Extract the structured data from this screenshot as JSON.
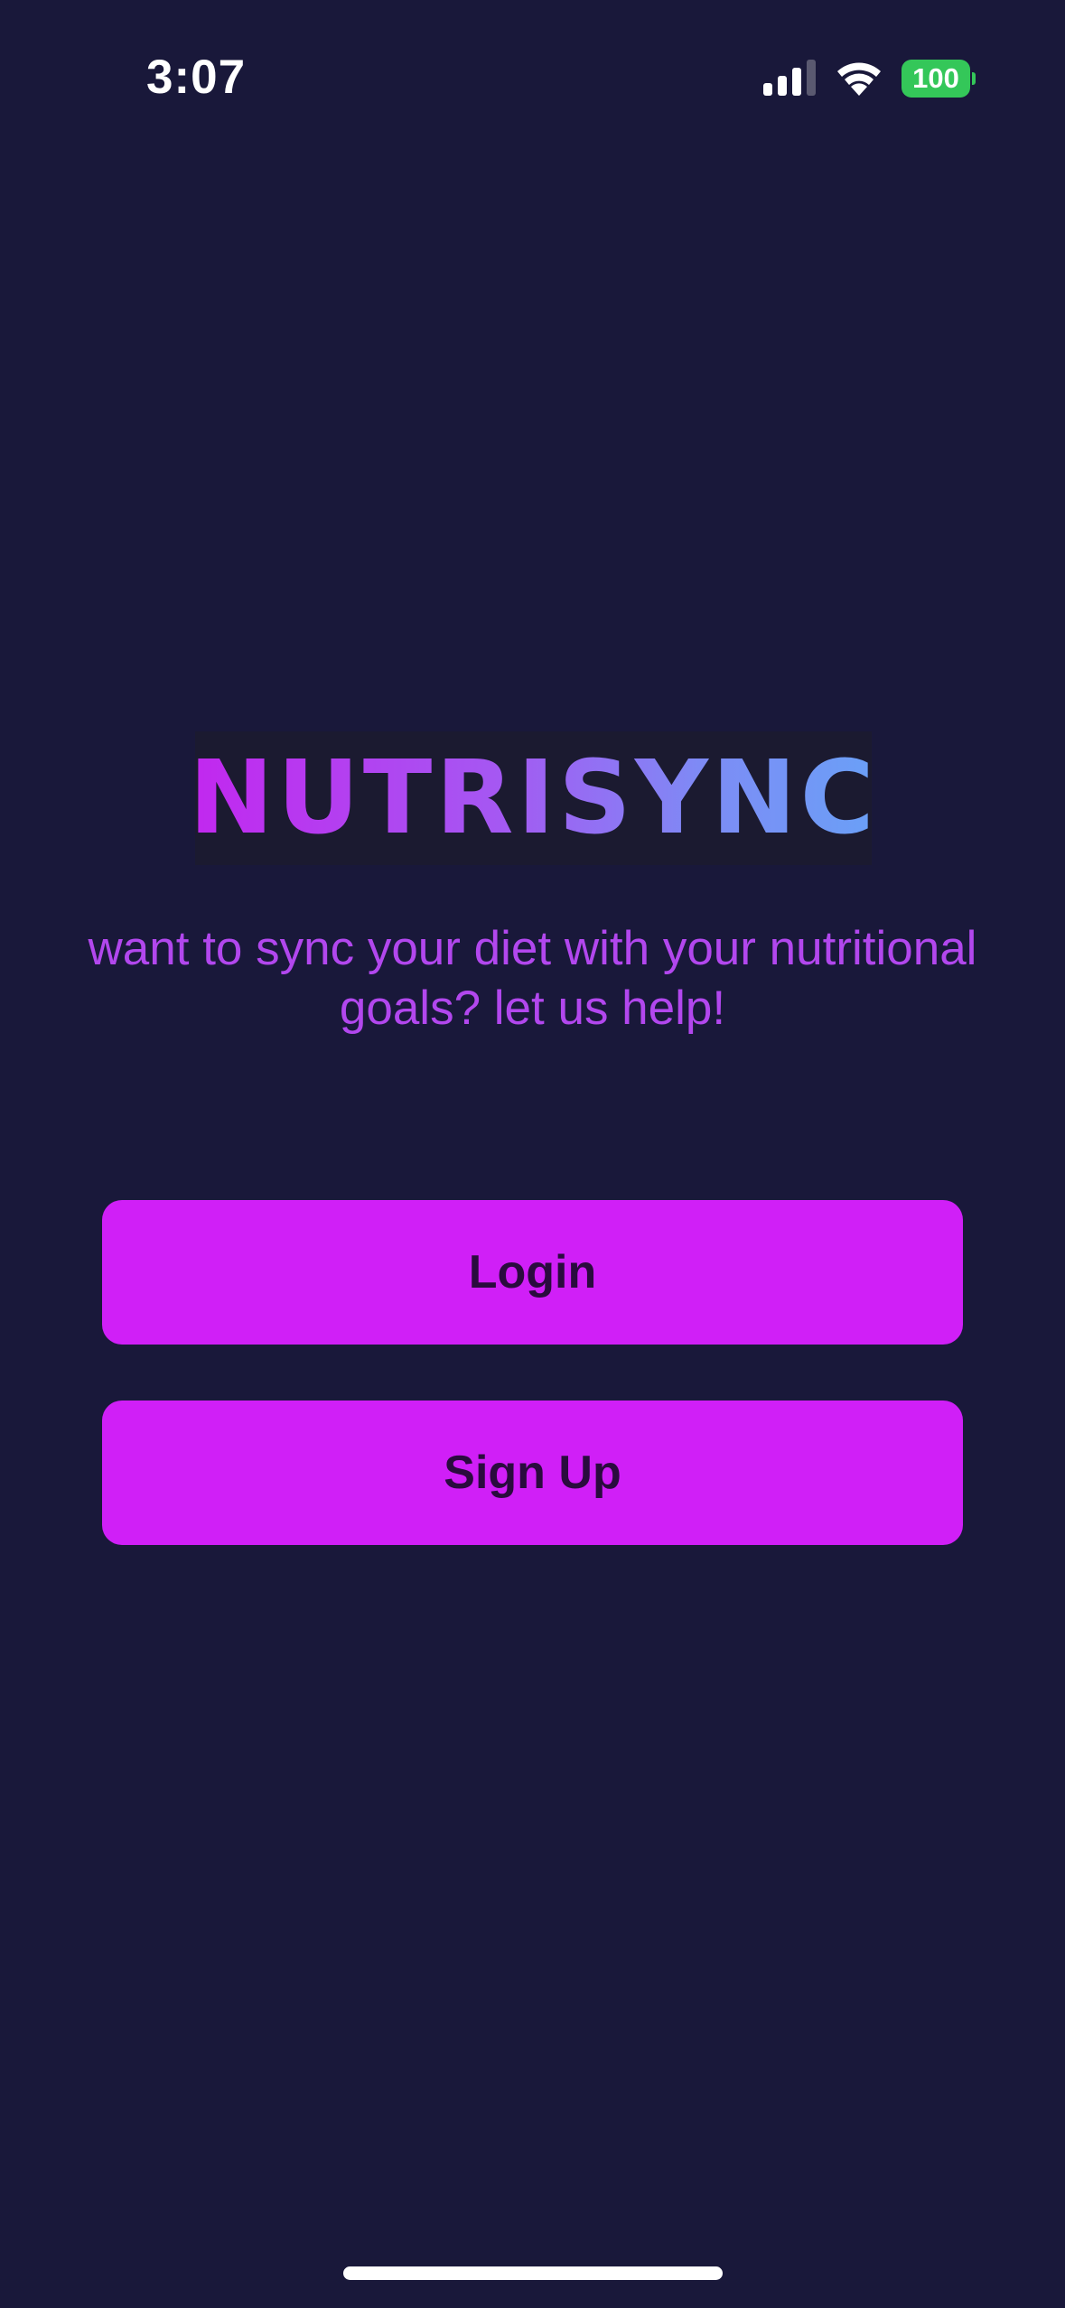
{
  "status_bar": {
    "time": "3:07",
    "battery": "100",
    "signal_icon": "cellular-signal-icon",
    "wifi_icon": "wifi-icon",
    "battery_icon": "battery-icon"
  },
  "app": {
    "logo": "NUTRISYNC",
    "tagline": "want to sync your diet with your nutritional goals? let us help!"
  },
  "actions": {
    "login_label": "Login",
    "signup_label": "Sign Up"
  },
  "colors": {
    "background": "#19183a",
    "button": "#d01ff7",
    "button_text": "#2a0b3e",
    "tagline": "#b247ee",
    "logo_gradient_start": "#c227ef",
    "logo_gradient_end": "#6aa0f7",
    "battery": "#34c759"
  }
}
